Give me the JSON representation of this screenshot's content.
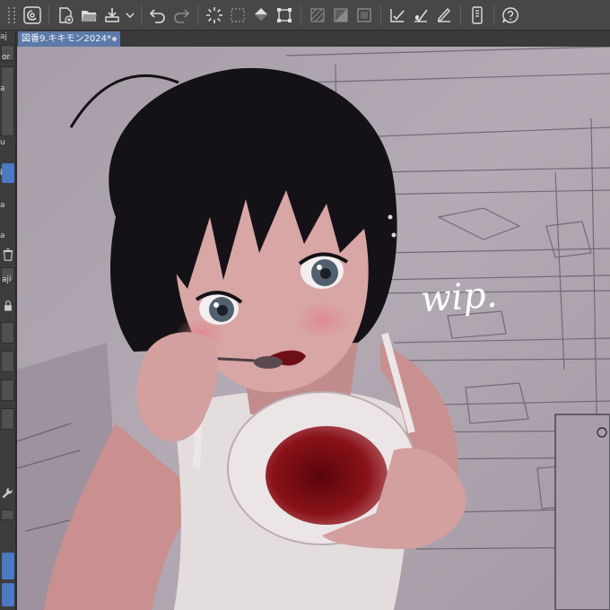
{
  "toolbar": {
    "icons": [
      "menu-logo-icon",
      "new-file-icon",
      "open-folder-icon",
      "save-icon",
      "undo-icon",
      "redo-icon",
      "loading-spinner-icon",
      "selection-icon",
      "fill-icon",
      "transform-icon",
      "pattern-icon",
      "layer-icon",
      "frame-icon",
      "checkmark-tool-icon",
      "brush-check-icon",
      "pen-check-icon",
      "tablet-icon",
      "help-icon"
    ]
  },
  "document_tab": {
    "title": "図番9.キキモン2024*"
  },
  "left_panel": {
    "labels": [
      "aj",
      "or",
      "a",
      "u",
      "i",
      "a",
      "a",
      "aji"
    ]
  },
  "canvas": {
    "handwriting": "wip.",
    "colors": {
      "background": "#b0a6b0",
      "hair": "#141216",
      "skin": "#d9a7a6",
      "shirt": "#e3ddde",
      "soup": "#7a0d12"
    }
  }
}
